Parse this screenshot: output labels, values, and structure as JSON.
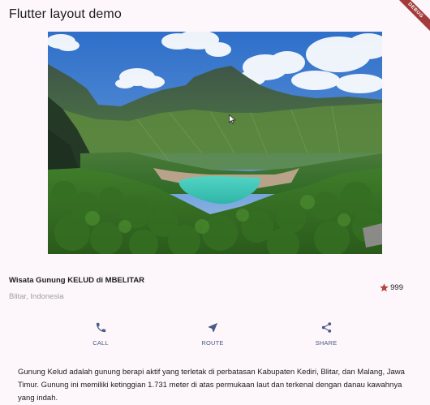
{
  "appbar": {
    "title": "Flutter layout demo",
    "debug_banner": "DEBUG"
  },
  "image": {
    "subject": "crater lake among green mountains"
  },
  "place": {
    "name": "Wisata Gunung KELUD di MBELITAR",
    "location": "Blitar, Indonesia",
    "rating_icon": "star-icon",
    "rating_count": "999"
  },
  "actions": [
    {
      "icon": "phone-icon",
      "label": "CALL"
    },
    {
      "icon": "navigation-icon",
      "label": "ROUTE"
    },
    {
      "icon": "share-icon",
      "label": "SHARE"
    }
  ],
  "description": "Gunung Kelud adalah gunung berapi aktif yang terletak di perbatasan Kabupaten Kediri, Blitar, dan Malang, Jawa Timur. Gunung ini memiliki ketinggian 1.731 meter di atas permukaan laut dan terkenal dengan danau kawahnya yang indah.",
  "colors": {
    "background": "#fdf7fb",
    "accent": "#4a5a85",
    "star": "#b0463b",
    "lake": "#3cc9b8"
  }
}
